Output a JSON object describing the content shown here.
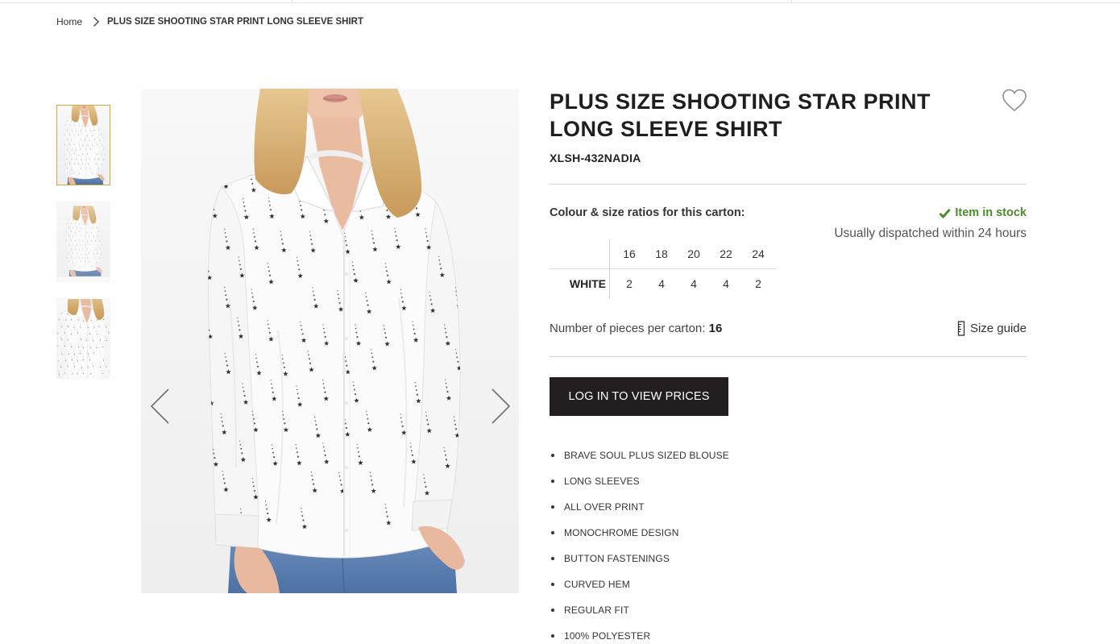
{
  "theme": {
    "accent": "#d4a63a",
    "stock_green": "#4c8a2c",
    "button_bg": "#231f20",
    "text": "#2b2b2b"
  },
  "icons": {
    "breadcrumb_separator": "chevron-right-icon",
    "wishlist": "heart-icon",
    "stock": "check-icon",
    "size_guide": "ruler-icon",
    "gallery_prev": "chevron-left-icon",
    "gallery_next": "chevron-right-icon"
  },
  "breadcrumb": {
    "home": "Home",
    "current": "PLUS SIZE SHOOTING STAR PRINT LONG SLEEVE SHIRT"
  },
  "gallery": {
    "thumbnails": [
      {
        "selected": true
      },
      {
        "selected": false
      },
      {
        "selected": false
      }
    ]
  },
  "product": {
    "title": "PLUS SIZE SHOOTING STAR PRINT LONG SLEEVE SHIRT",
    "sku": "XLSH-432NADIA",
    "ratios_label": "Colour & size ratios for this carton:",
    "stock_status": "Item in stock",
    "dispatch_note": "Usually dispatched within 24 hours",
    "size_table": {
      "sizes": [
        "16",
        "18",
        "20",
        "22",
        "24"
      ],
      "rows": [
        {
          "colour": "WHITE",
          "quantities": [
            "2",
            "4",
            "4",
            "4",
            "2"
          ]
        }
      ]
    },
    "pieces_label": "Number of pieces per carton:",
    "pieces_value": "16",
    "size_guide_label": "Size guide",
    "login_button": "LOG IN TO VIEW PRICES",
    "features": [
      "BRAVE SOUL PLUS SIZED BLOUSE",
      "LONG SLEEVES",
      "ALL OVER PRINT",
      "MONOCHROME DESIGN",
      "BUTTON FASTENINGS",
      "CURVED HEM",
      "REGULAR FIT",
      "100% POLYESTER"
    ]
  }
}
